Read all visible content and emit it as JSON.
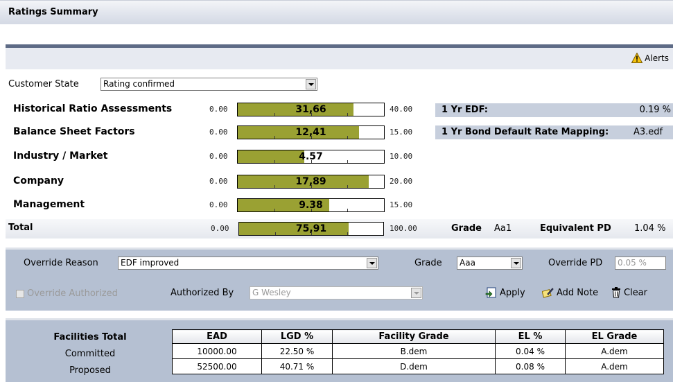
{
  "header": {
    "title": "Ratings Summary"
  },
  "alerts": {
    "label": "Alerts",
    "icon": "warning-icon"
  },
  "customer_state": {
    "label": "Customer State",
    "value": "Rating confirmed"
  },
  "assessments": [
    {
      "label": "Historical Ratio Assessments",
      "min": "0.00",
      "value": "31,66",
      "max": "40.00",
      "fraction": 0.79
    },
    {
      "label": "Balance Sheet Factors",
      "min": "0.00",
      "value": "12,41",
      "max": "15.00",
      "fraction": 0.83
    },
    {
      "label": "Industry / Market",
      "min": "0.00",
      "value": "4.57",
      "max": "10.00",
      "fraction": 0.457
    },
    {
      "label": "Company",
      "min": "0.00",
      "value": "17,89",
      "max": "20.00",
      "fraction": 0.895
    },
    {
      "label": "Management",
      "min": "0.00",
      "value": "9.38",
      "max": "15.00",
      "fraction": 0.625
    }
  ],
  "total": {
    "label": "Total",
    "min": "0.00",
    "value": "75,91",
    "max": "100.00",
    "fraction": 0.76
  },
  "edf": {
    "label": "1 Yr EDF:",
    "value": "0.19 %"
  },
  "bond_mapping": {
    "label": "1 Yr Bond Default Rate Mapping:",
    "value": "A3.edf"
  },
  "grade": {
    "label": "Grade",
    "value": "Aa1",
    "pd_label": "Equivalent PD",
    "pd_value": "1.04 %"
  },
  "override": {
    "reason_label": "Override Reason",
    "reason_value": "EDF improved",
    "grade_label": "Grade",
    "grade_value": "Aaa",
    "pd_label": "Override PD",
    "pd_value": "0.05 %",
    "authorized_label": "Override Authorized",
    "authorized_by_label": "Authorized By",
    "authorized_by_value": "G Wesley",
    "apply_label": "Apply",
    "add_note_label": "Add Note",
    "clear_label": "Clear"
  },
  "facilities": {
    "title": "Facilities Total",
    "columns": [
      "EAD",
      "LGD %",
      "Facility Grade",
      "EL %",
      "EL Grade"
    ],
    "rows": [
      {
        "label": "Committed",
        "cells": [
          "10000.00",
          "22.50 %",
          "B.dem",
          "0.04 %",
          "A.dem"
        ]
      },
      {
        "label": "Proposed",
        "cells": [
          "52500.00",
          "40.71 %",
          "D.dem",
          "0.08 %",
          "A.dem"
        ]
      }
    ]
  },
  "colors": {
    "bar_fill": "#9aa133",
    "panel": "#b5c0d2",
    "header_dark": "#5e6b86",
    "info_box": "#c7cfdd"
  }
}
